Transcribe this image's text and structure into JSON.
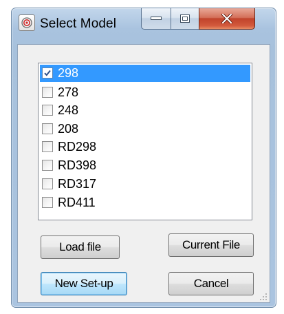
{
  "window": {
    "title": "Select Model",
    "icon": "target-icon"
  },
  "caption_buttons": {
    "minimize_icon": "minimize-icon",
    "maximize_icon": "maximize-icon",
    "close_icon": "close-icon"
  },
  "model_list": {
    "items": [
      {
        "label": "298",
        "checked": true,
        "selected": true
      },
      {
        "label": "278",
        "checked": false,
        "selected": false
      },
      {
        "label": "248",
        "checked": false,
        "selected": false
      },
      {
        "label": "208",
        "checked": false,
        "selected": false
      },
      {
        "label": "RD298",
        "checked": false,
        "selected": false
      },
      {
        "label": "RD398",
        "checked": false,
        "selected": false
      },
      {
        "label": "RD317",
        "checked": false,
        "selected": false
      },
      {
        "label": "RD411",
        "checked": false,
        "selected": false
      }
    ]
  },
  "buttons": {
    "load_file": "Load file",
    "current_file": "Current File",
    "new_setup": "New Set-up",
    "cancel": "Cancel"
  },
  "colors": {
    "selection": "#3399ff",
    "titlebar": "#a9c3df",
    "close_button": "#c1432b"
  }
}
